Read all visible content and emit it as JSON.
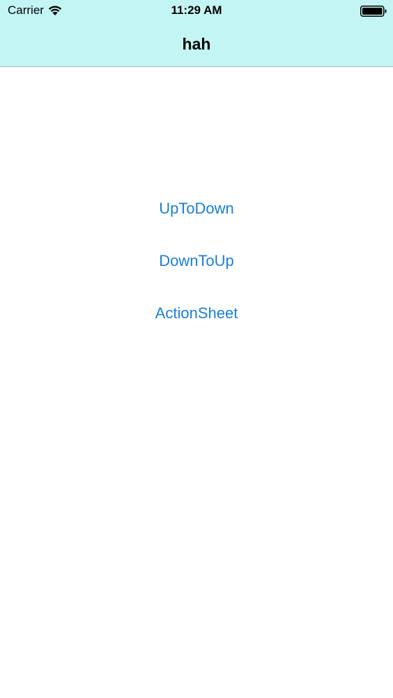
{
  "status_bar": {
    "carrier": "Carrier",
    "time": "11:29 AM",
    "wifi_icon": "wifi-icon",
    "battery_icon": "battery-icon"
  },
  "nav_bar": {
    "title": "hah",
    "background": "#c4f5f5"
  },
  "buttons": [
    {
      "label": "UpToDown"
    },
    {
      "label": "DownToUp"
    },
    {
      "label": "ActionSheet"
    }
  ],
  "colors": {
    "accent": "#1a7fd6"
  }
}
